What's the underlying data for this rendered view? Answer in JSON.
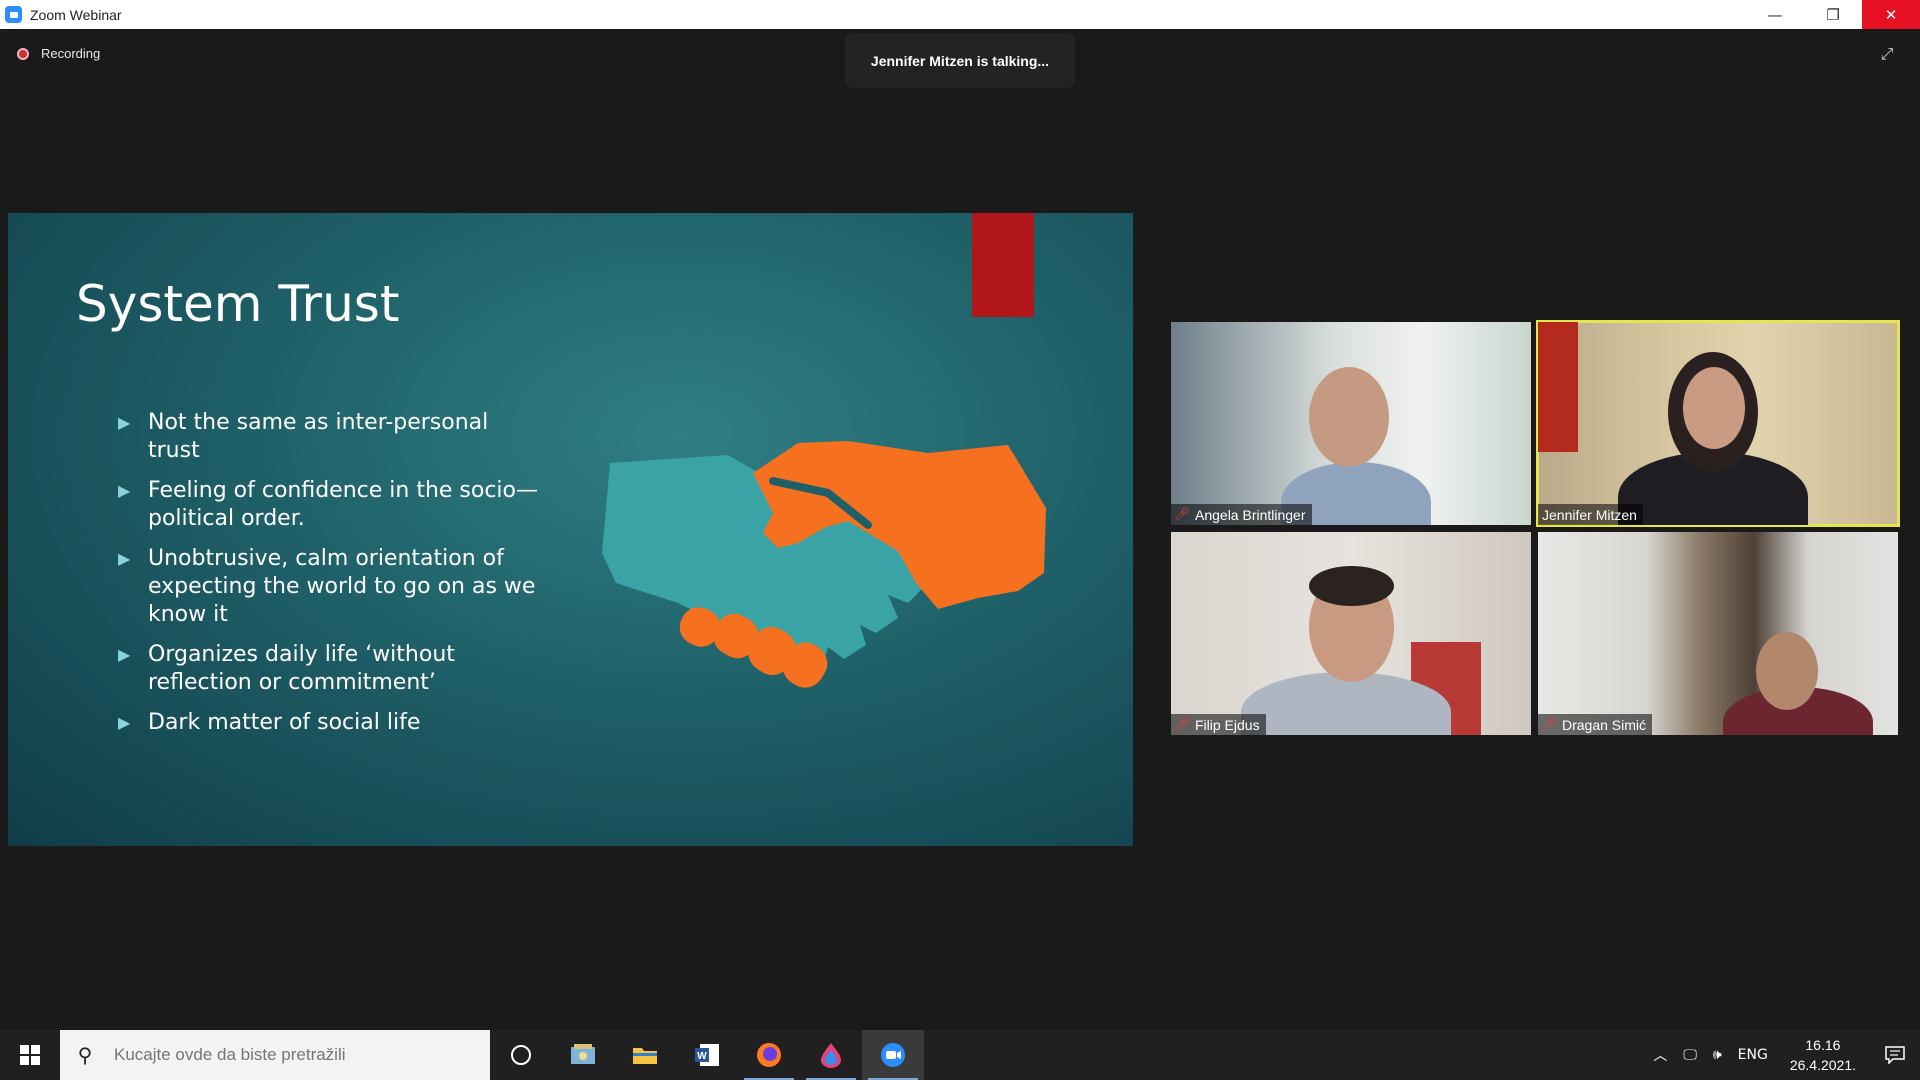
{
  "window": {
    "title": "Zoom Webinar",
    "controls": {
      "minimize": "—",
      "restore": "❐",
      "close": "✕"
    }
  },
  "meeting": {
    "recording_label": "Recording",
    "talking_banner": "Jennifer Mitzen is talking...",
    "expand_icon": "⤢"
  },
  "slide": {
    "title": "System Trust",
    "bullets": [
      "Not the same as inter-personal trust",
      "Feeling of confidence in the socio—political order.",
      "Unobtrusive, calm orientation of expecting the world to go on as we know it",
      "Organizes daily life ‘without reflection or commitment’",
      "Dark matter of social life"
    ],
    "colors": {
      "teal_hand": "#3aa3a5",
      "orange_hand": "#f5711f",
      "red_tab": "#b1161b"
    }
  },
  "participants": [
    {
      "name": "Angela Brintlinger",
      "muted": true,
      "active": false
    },
    {
      "name": "Jennifer Mitzen",
      "muted": false,
      "active": true
    },
    {
      "name": "Filip Ejdus",
      "muted": true,
      "active": false
    },
    {
      "name": "Dragan Simić",
      "muted": true,
      "active": false
    }
  ],
  "taskbar": {
    "search_placeholder": "Kucajte ovde da biste pretražili",
    "language": "ENG",
    "time": "16.16",
    "date": "26.4.2021.",
    "apps": [
      "task-view",
      "photos",
      "file-explorer",
      "word",
      "firefox",
      "drop-app",
      "zoom"
    ]
  }
}
